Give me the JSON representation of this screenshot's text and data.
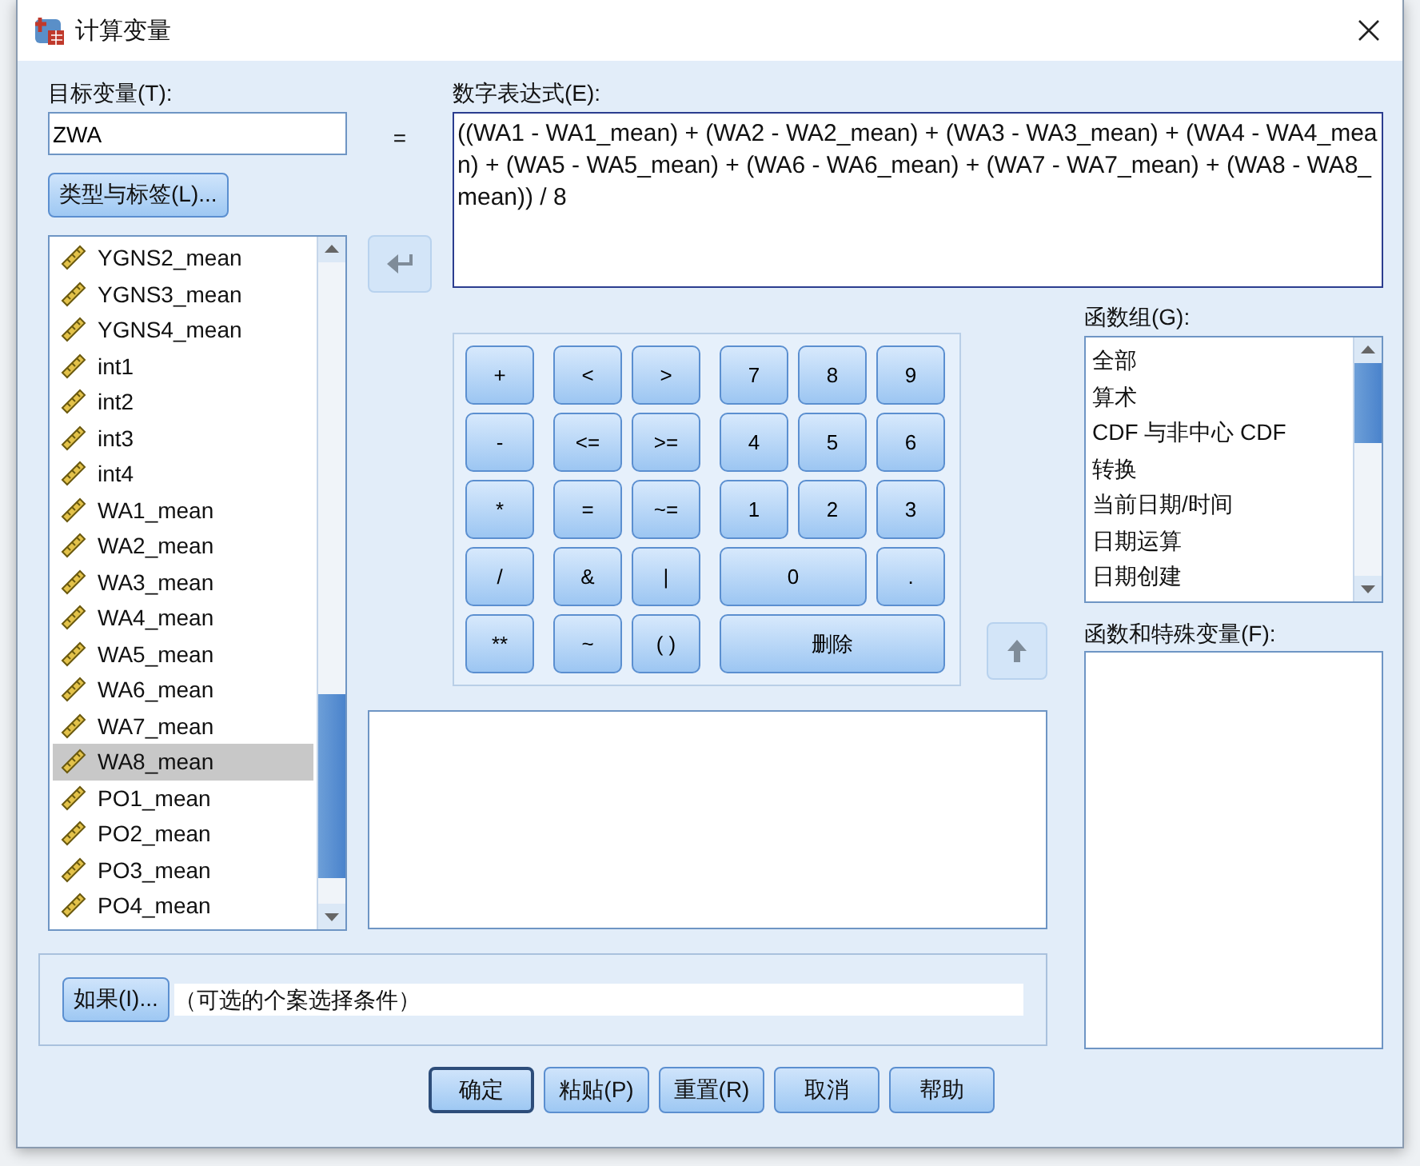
{
  "window": {
    "title": "计算变量"
  },
  "target_variable": {
    "label": "目标变量(T):",
    "value": "ZWA"
  },
  "equals_sign": "=",
  "type_label_button": "类型与标签(L)...",
  "variables": [
    {
      "name": "YGNS2_mean",
      "selected": false
    },
    {
      "name": "YGNS3_mean",
      "selected": false
    },
    {
      "name": "YGNS4_mean",
      "selected": false
    },
    {
      "name": "int1",
      "selected": false
    },
    {
      "name": "int2",
      "selected": false
    },
    {
      "name": "int3",
      "selected": false
    },
    {
      "name": "int4",
      "selected": false
    },
    {
      "name": "WA1_mean",
      "selected": false
    },
    {
      "name": "WA2_mean",
      "selected": false
    },
    {
      "name": "WA3_mean",
      "selected": false
    },
    {
      "name": "WA4_mean",
      "selected": false
    },
    {
      "name": "WA5_mean",
      "selected": false
    },
    {
      "name": "WA6_mean",
      "selected": false
    },
    {
      "name": "WA7_mean",
      "selected": false
    },
    {
      "name": "WA8_mean",
      "selected": true
    },
    {
      "name": "PO1_mean",
      "selected": false
    },
    {
      "name": "PO2_mean",
      "selected": false
    },
    {
      "name": "PO3_mean",
      "selected": false
    },
    {
      "name": "PO4_mean",
      "selected": false
    }
  ],
  "numeric_expression": {
    "label": "数字表达式(E):",
    "value": "((WA1 - WA1_mean) + (WA2 - WA2_mean) + (WA3 - WA3_mean) + (WA4 - WA4_mean) + (WA5 - WA5_mean) + (WA6 - WA6_mean) + (WA7 - WA7_mean) + (WA8 - WA8_mean)) / 8"
  },
  "keypad": [
    {
      "label": "+",
      "kind": "key"
    },
    {
      "label": "<",
      "kind": "key"
    },
    {
      "label": ">",
      "kind": "key"
    },
    {
      "label": "7",
      "kind": "key"
    },
    {
      "label": "8",
      "kind": "key"
    },
    {
      "label": "9",
      "kind": "key"
    },
    {
      "label": "-",
      "kind": "key"
    },
    {
      "label": "<=",
      "kind": "key"
    },
    {
      "label": ">=",
      "kind": "key"
    },
    {
      "label": "4",
      "kind": "key"
    },
    {
      "label": "5",
      "kind": "key"
    },
    {
      "label": "6",
      "kind": "key"
    },
    {
      "label": "*",
      "kind": "key"
    },
    {
      "label": "=",
      "kind": "key"
    },
    {
      "label": "~=",
      "kind": "key"
    },
    {
      "label": "1",
      "kind": "key"
    },
    {
      "label": "2",
      "kind": "key"
    },
    {
      "label": "3",
      "kind": "key"
    },
    {
      "label": "/",
      "kind": "key"
    },
    {
      "label": "&",
      "kind": "key"
    },
    {
      "label": "|",
      "kind": "key"
    },
    {
      "label": "0",
      "kind": "double"
    },
    {
      "label": ".",
      "kind": "key"
    },
    {
      "label": "**",
      "kind": "key"
    },
    {
      "label": "~",
      "kind": "key"
    },
    {
      "label": "( )",
      "kind": "key"
    },
    {
      "label": "删除",
      "kind": "triple"
    }
  ],
  "function_group": {
    "label": "函数组(G):",
    "items": [
      "全部",
      "算术",
      "CDF 与非中心 CDF",
      "转换",
      "当前日期/时间",
      "日期运算",
      "日期创建"
    ]
  },
  "functions_label": "函数和特殊变量(F):",
  "if_button": "如果(I)...",
  "if_condition": "（可选的个案选择条件）",
  "buttons": [
    {
      "label": "确定",
      "default": true
    },
    {
      "label": "粘贴(P)",
      "default": false
    },
    {
      "label": "重置(R)",
      "default": false
    },
    {
      "label": "取消",
      "default": false
    },
    {
      "label": "帮助",
      "default": false
    }
  ]
}
